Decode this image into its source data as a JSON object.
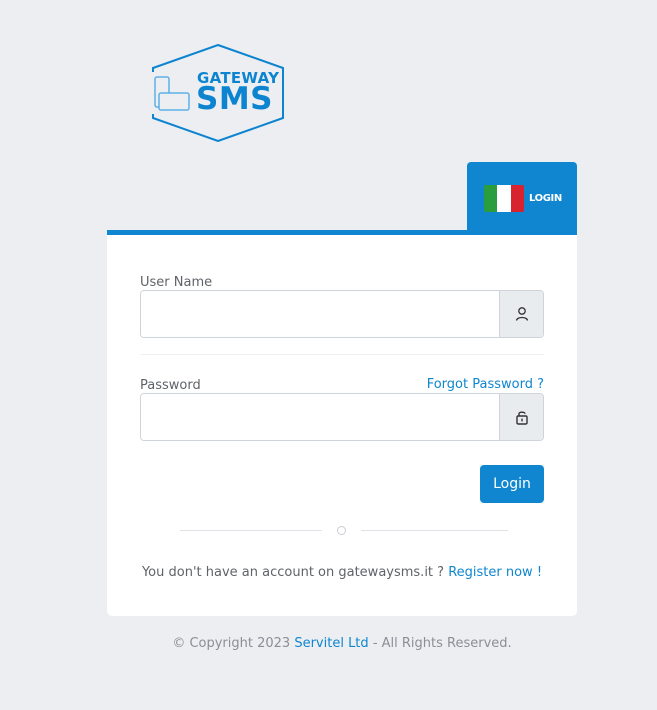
{
  "logo": {
    "top_text": "GATEWAY",
    "main_text": "SMS",
    "color": "#0d84d0"
  },
  "language": {
    "label": "LOGIN",
    "flag": "italy-flag"
  },
  "form": {
    "username_label": "User Name",
    "username_value": "",
    "username_icon": "user-icon",
    "password_label": "Password",
    "password_value": "",
    "password_icon": "lock-icon",
    "forgot_label": "Forgot Password ?",
    "login_label": "Login"
  },
  "register": {
    "prompt": "You don't have an account on gatewaysms.it ?",
    "link_label": "Register now !"
  },
  "footer": {
    "prefix": "© Copyright 2023",
    "company": "Servitel Ltd",
    "suffix": "- All Rights Reserved."
  },
  "colors": {
    "accent": "#0f86cf",
    "background": "#eceef2"
  }
}
